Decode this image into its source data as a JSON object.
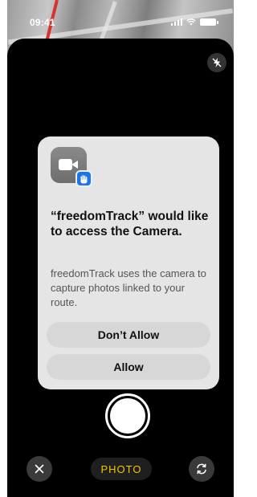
{
  "status": {
    "time": "09:41"
  },
  "dialog": {
    "title": "“freedomTrack” would like to access the Camera.",
    "message": "freedomTrack uses the camera to capture photos linked to your route.",
    "deny_label": "Don’t Allow",
    "allow_label": "Allow",
    "icon": "camera-app-icon",
    "badge_icon": "hand-icon"
  },
  "camera": {
    "mode_label": "PHOTO",
    "flash_icon": "flash-off-icon",
    "close_icon": "close-icon",
    "flip_icon": "flip-camera-icon"
  },
  "colors": {
    "mode_accent": "#f5c400",
    "badge_blue": "#1d74e8",
    "dialog_bg": "#eeeeee",
    "button_bg": "#d7d7d7"
  }
}
